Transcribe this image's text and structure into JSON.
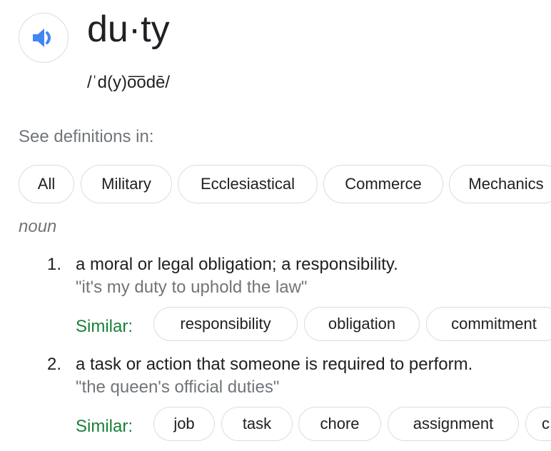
{
  "entry": {
    "speaker_icon": "speaker-icon",
    "word": "du·ty",
    "phonetic": "/ˈd(y)o͞odē/"
  },
  "see_definitions_label": "See definitions in:",
  "domains": [
    "All",
    "Military",
    "Ecclesiastical",
    "Commerce",
    "Mechanics"
  ],
  "part_of_speech": "noun",
  "similar_label": "Similar:",
  "definitions": [
    {
      "number": "1.",
      "text": "a moral or legal obligation; a responsibility.",
      "example": "\"it's my duty to uphold the law\"",
      "similar": [
        "responsibility",
        "obligation",
        "commitment"
      ]
    },
    {
      "number": "2.",
      "text": "a task or action that someone is required to perform.",
      "example": "\"the queen's official duties\"",
      "similar": [
        "job",
        "task",
        "chore",
        "assignment",
        "c"
      ]
    }
  ],
  "colors": {
    "speaker_icon": "#4285f4",
    "similar_label": "#188038",
    "muted_text": "#70757a",
    "chip_border": "#dadce0"
  }
}
